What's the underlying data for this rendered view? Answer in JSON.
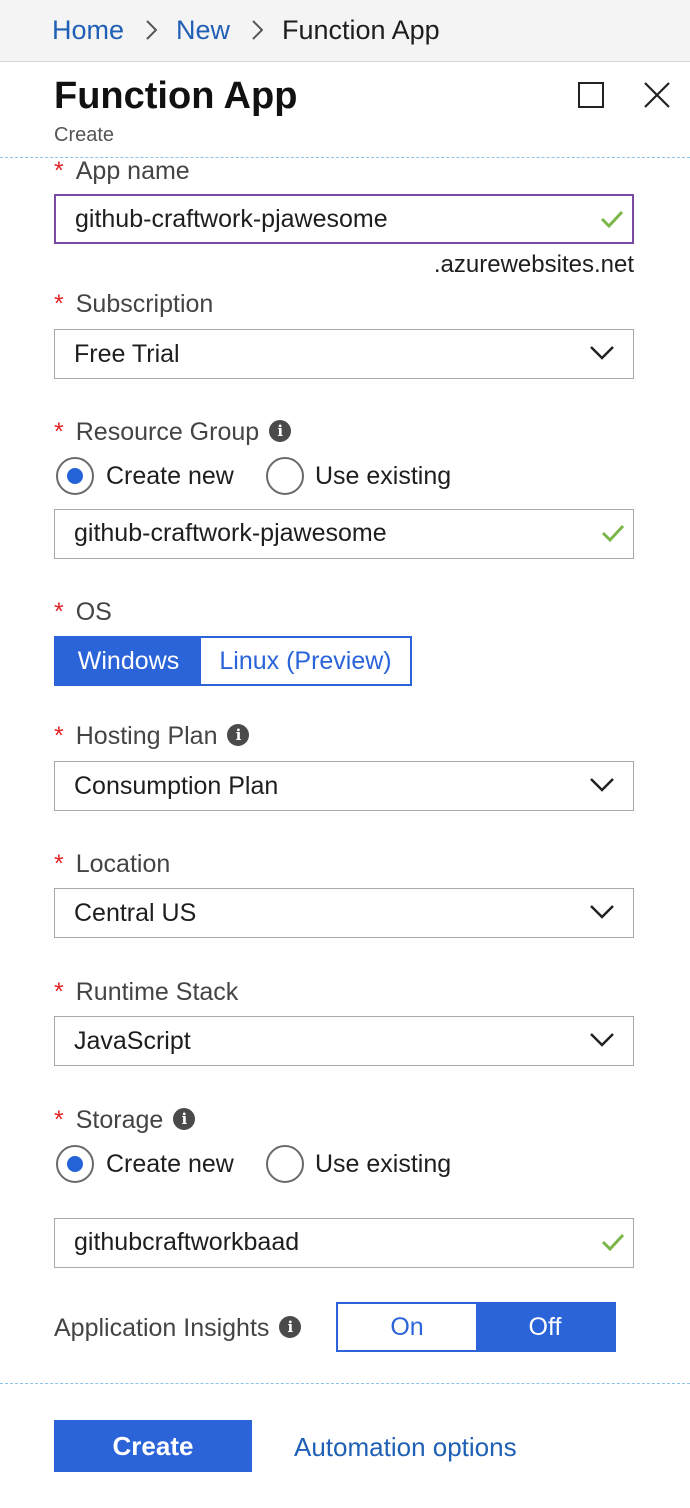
{
  "breadcrumb": {
    "home": "Home",
    "new": "New",
    "current": "Function App"
  },
  "blade": {
    "title": "Function App",
    "subtitle": "Create"
  },
  "form": {
    "app_name": {
      "label": "App name",
      "value": "github-craftwork-pjawesome",
      "suffix": ".azurewebsites.net",
      "valid": true
    },
    "subscription": {
      "label": "Subscription",
      "value": "Free Trial"
    },
    "resource_group": {
      "label": "Resource Group",
      "option_new": "Create new",
      "option_existing": "Use existing",
      "selected": "Create new",
      "value": "github-craftwork-pjawesome",
      "valid": true
    },
    "os": {
      "label": "OS",
      "options": [
        "Windows",
        "Linux (Preview)"
      ],
      "selected": "Windows"
    },
    "hosting_plan": {
      "label": "Hosting Plan",
      "value": "Consumption Plan"
    },
    "location": {
      "label": "Location",
      "value": "Central US"
    },
    "runtime_stack": {
      "label": "Runtime Stack",
      "value": "JavaScript"
    },
    "storage": {
      "label": "Storage",
      "option_new": "Create new",
      "option_existing": "Use existing",
      "selected": "Create new",
      "value": "githubcraftworkbaad",
      "valid": true
    },
    "app_insights": {
      "label": "Application Insights",
      "options": [
        "On",
        "Off"
      ],
      "selected": "Off"
    }
  },
  "footer": {
    "create_label": "Create",
    "automation_label": "Automation options"
  },
  "colors": {
    "accent": "#2b63d9",
    "link": "#1f5fb5",
    "required": "#e0242a",
    "valid": "#7ab648",
    "focus_border": "#7b4aa6"
  },
  "icons": {
    "info": "info-icon",
    "check": "checkmark-icon",
    "dropdown": "chevron-down-icon",
    "maximize": "maximize-icon",
    "close": "close-icon"
  }
}
